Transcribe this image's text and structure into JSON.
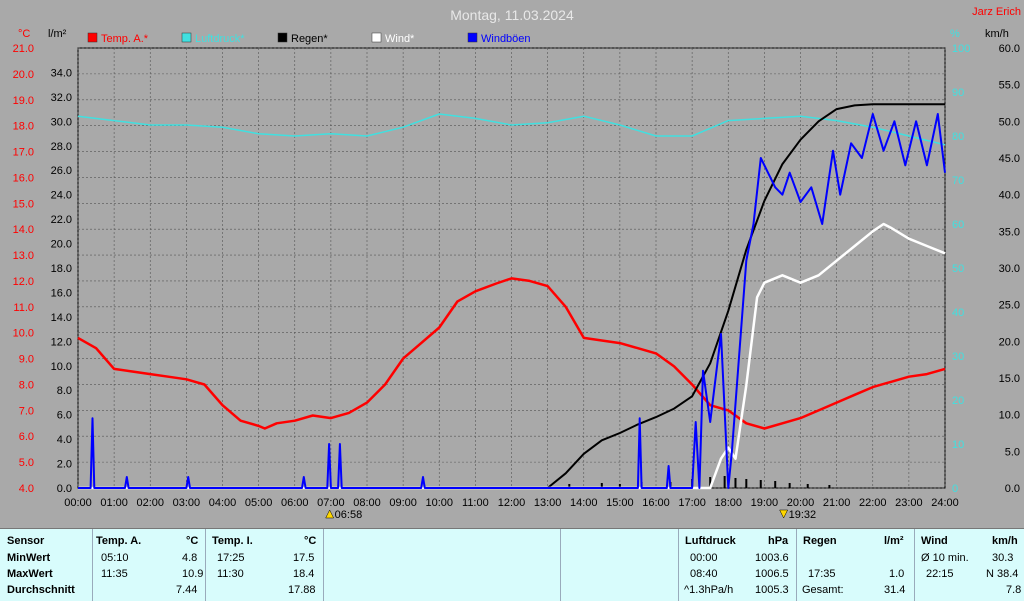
{
  "header": {
    "title": "Montag, 11.03.2024",
    "author": "Jarz Erich"
  },
  "colors": {
    "temp": "#ff0000",
    "pressure": "#40e0e0",
    "rain": "#000000",
    "wind": "#ffffff",
    "gust": "#0000ff",
    "plot_bg": "#a9a9a9",
    "table_bg": "#d8fcfc"
  },
  "legend": [
    {
      "label": "Temp. A.*",
      "color": "#ff0000"
    },
    {
      "label": "Luftdruck*",
      "color": "#40e0e0"
    },
    {
      "label": "Regen*",
      "color": "#000000"
    },
    {
      "label": "Wind*",
      "color": "#ffffff"
    },
    {
      "label": "Windböen",
      "color": "#0000ff"
    }
  ],
  "axes": {
    "temp_unit": "°C",
    "rain_unit": "l/m²",
    "pressure_unit": "%",
    "wind_unit": "km/h",
    "temp_ticks": [
      "21.0",
      "20.0",
      "19.0",
      "18.0",
      "17.0",
      "16.0",
      "15.0",
      "14.0",
      "13.0",
      "12.0",
      "11.0",
      "10.0",
      "9.0",
      "8.0",
      "7.0",
      "6.0",
      "5.0",
      "4.0"
    ],
    "rain_ticks": [
      "34.0",
      "32.0",
      "30.0",
      "28.0",
      "26.0",
      "24.0",
      "22.0",
      "20.0",
      "18.0",
      "16.0",
      "14.0",
      "12.0",
      "10.0",
      "8.0",
      "6.0",
      "4.0",
      "2.0",
      "0.0"
    ],
    "pct_ticks": [
      "100",
      "90",
      "80",
      "70",
      "60",
      "50",
      "40",
      "30",
      "20",
      "10",
      "0"
    ],
    "wind_ticks": [
      "60.0",
      "55.0",
      "50.0",
      "45.0",
      "40.0",
      "35.0",
      "30.0",
      "25.0",
      "20.0",
      "15.0",
      "10.0",
      "5.0",
      "0.0"
    ],
    "time_ticks": [
      "00:00",
      "01:00",
      "02:00",
      "03:00",
      "04:00",
      "05:00",
      "06:00",
      "07:00",
      "08:00",
      "09:00",
      "10:00",
      "11:00",
      "12:00",
      "13:00",
      "14:00",
      "15:00",
      "16:00",
      "17:00",
      "18:00",
      "19:00",
      "20:00",
      "21:00",
      "22:00",
      "23:00",
      "24:00"
    ],
    "sunrise": "06:58",
    "sunset": "19:32"
  },
  "chart_data": {
    "type": "line",
    "x_unit": "hours",
    "series": [
      {
        "name": "Temp. A.*",
        "axis": "temp_C",
        "points": [
          [
            0,
            9.8
          ],
          [
            0.5,
            9.4
          ],
          [
            1,
            8.6
          ],
          [
            1.5,
            8.5
          ],
          [
            2,
            8.4
          ],
          [
            2.5,
            8.3
          ],
          [
            3,
            8.2
          ],
          [
            3.5,
            8.0
          ],
          [
            4,
            7.2
          ],
          [
            4.5,
            6.6
          ],
          [
            5,
            6.4
          ],
          [
            5.17,
            6.3
          ],
          [
            5.5,
            6.5
          ],
          [
            6,
            6.6
          ],
          [
            6.5,
            6.8
          ],
          [
            7,
            6.7
          ],
          [
            7.5,
            6.9
          ],
          [
            8,
            7.3
          ],
          [
            8.5,
            8.0
          ],
          [
            9,
            9.0
          ],
          [
            9.5,
            9.6
          ],
          [
            10,
            10.2
          ],
          [
            10.5,
            11.2
          ],
          [
            11,
            11.6
          ],
          [
            11.58,
            11.9
          ],
          [
            12,
            12.1
          ],
          [
            12.5,
            12.0
          ],
          [
            13,
            11.8
          ],
          [
            13.5,
            11.0
          ],
          [
            14,
            9.8
          ],
          [
            14.5,
            9.7
          ],
          [
            15,
            9.6
          ],
          [
            15.5,
            9.4
          ],
          [
            16,
            9.2
          ],
          [
            16.5,
            8.7
          ],
          [
            17,
            8.0
          ],
          [
            17.5,
            7.2
          ],
          [
            18,
            7.0
          ],
          [
            18.5,
            6.5
          ],
          [
            19,
            6.3
          ],
          [
            19.5,
            6.5
          ],
          [
            20,
            6.7
          ],
          [
            20.5,
            7.0
          ],
          [
            21,
            7.3
          ],
          [
            21.5,
            7.6
          ],
          [
            22,
            7.9
          ],
          [
            22.5,
            8.1
          ],
          [
            23,
            8.3
          ],
          [
            23.5,
            8.4
          ],
          [
            24,
            8.6
          ]
        ]
      },
      {
        "name": "Luftdruck*",
        "axis": "pct",
        "points": [
          [
            0,
            84.5
          ],
          [
            1,
            83.5
          ],
          [
            2,
            82.5
          ],
          [
            3,
            82.5
          ],
          [
            4,
            82
          ],
          [
            5,
            80.5
          ],
          [
            6,
            80
          ],
          [
            7,
            80.5
          ],
          [
            8,
            80
          ],
          [
            9,
            82
          ],
          [
            10,
            85
          ],
          [
            11,
            84
          ],
          [
            12,
            82.5
          ],
          [
            13,
            83
          ],
          [
            14,
            84.5
          ],
          [
            15,
            82.5
          ],
          [
            16,
            80
          ],
          [
            17,
            80
          ],
          [
            18,
            83.5
          ],
          [
            19,
            84
          ],
          [
            20,
            84.5
          ],
          [
            21,
            83.5
          ],
          [
            22,
            82
          ],
          [
            23,
            80
          ],
          [
            24,
            78
          ]
        ]
      },
      {
        "name": "Regen*",
        "axis": "rain_lm2",
        "points": [
          [
            0,
            0
          ],
          [
            13,
            0
          ],
          [
            13.5,
            1.2
          ],
          [
            14,
            2.8
          ],
          [
            14.5,
            3.9
          ],
          [
            15,
            4.5
          ],
          [
            15.5,
            5.2
          ],
          [
            16,
            5.8
          ],
          [
            16.5,
            6.5
          ],
          [
            17,
            7.5
          ],
          [
            17.5,
            10.2
          ],
          [
            18,
            14.5
          ],
          [
            18.5,
            19.5
          ],
          [
            19,
            23.5
          ],
          [
            19.5,
            26.5
          ],
          [
            20,
            28.5
          ],
          [
            20.5,
            30.0
          ],
          [
            21,
            31.0
          ],
          [
            21.5,
            31.3
          ],
          [
            22,
            31.4
          ],
          [
            24,
            31.4
          ]
        ]
      },
      {
        "name": "Wind*",
        "axis": "wind_kmh",
        "points": [
          [
            0,
            0
          ],
          [
            17.5,
            0
          ],
          [
            17.8,
            4
          ],
          [
            18,
            5.5
          ],
          [
            18.2,
            4
          ],
          [
            18.5,
            14
          ],
          [
            18.8,
            26
          ],
          [
            19,
            28
          ],
          [
            19.5,
            29
          ],
          [
            20,
            28
          ],
          [
            20.5,
            29
          ],
          [
            21,
            31
          ],
          [
            21.5,
            33
          ],
          [
            22,
            35
          ],
          [
            22.3,
            36
          ],
          [
            22.5,
            35.5
          ],
          [
            23,
            34
          ],
          [
            23.5,
            33
          ],
          [
            24,
            32
          ]
        ]
      },
      {
        "name": "Windböen",
        "axis": "wind_kmh",
        "points": [
          [
            0,
            0
          ],
          [
            0.35,
            0
          ],
          [
            0.4,
            9.5
          ],
          [
            0.45,
            0
          ],
          [
            1.3,
            0
          ],
          [
            1.35,
            1.5
          ],
          [
            1.4,
            0
          ],
          [
            3,
            0
          ],
          [
            3.05,
            1.5
          ],
          [
            3.1,
            0
          ],
          [
            6.2,
            0
          ],
          [
            6.25,
            1.5
          ],
          [
            6.3,
            0
          ],
          [
            6.9,
            0
          ],
          [
            6.95,
            6
          ],
          [
            7.0,
            0
          ],
          [
            7.2,
            0
          ],
          [
            7.25,
            6
          ],
          [
            7.3,
            0
          ],
          [
            9.5,
            0
          ],
          [
            9.55,
            1.5
          ],
          [
            9.6,
            0
          ],
          [
            15.5,
            0
          ],
          [
            15.55,
            9.5
          ],
          [
            15.6,
            0
          ],
          [
            16.3,
            0
          ],
          [
            16.35,
            3
          ],
          [
            16.4,
            0
          ],
          [
            17.0,
            0
          ],
          [
            17.1,
            9
          ],
          [
            17.2,
            0
          ],
          [
            17.3,
            16
          ],
          [
            17.5,
            9
          ],
          [
            17.8,
            21
          ],
          [
            18,
            0
          ],
          [
            18.1,
            5
          ],
          [
            18.3,
            18
          ],
          [
            18.5,
            31
          ],
          [
            18.7,
            36
          ],
          [
            18.9,
            45
          ],
          [
            19.1,
            43
          ],
          [
            19.3,
            41
          ],
          [
            19.5,
            40
          ],
          [
            19.7,
            43
          ],
          [
            20,
            39
          ],
          [
            20.3,
            41
          ],
          [
            20.6,
            36
          ],
          [
            20.9,
            46
          ],
          [
            21.1,
            40
          ],
          [
            21.4,
            47
          ],
          [
            21.7,
            45
          ],
          [
            22,
            51
          ],
          [
            22.3,
            46
          ],
          [
            22.6,
            50
          ],
          [
            22.9,
            44
          ],
          [
            23.2,
            50
          ],
          [
            23.5,
            44
          ],
          [
            23.8,
            51
          ],
          [
            24,
            43
          ]
        ]
      }
    ],
    "rain_bars": [
      [
        13.6,
        0.4
      ],
      [
        14.5,
        0.5
      ],
      [
        15.0,
        0.4
      ],
      [
        15.6,
        0.6
      ],
      [
        16.4,
        0.6
      ],
      [
        17.0,
        0.9
      ],
      [
        17.5,
        1.1
      ],
      [
        17.9,
        1.2
      ],
      [
        18.2,
        1.0
      ],
      [
        18.5,
        0.9
      ],
      [
        18.9,
        0.8
      ],
      [
        19.3,
        0.7
      ],
      [
        19.7,
        0.5
      ],
      [
        20.2,
        0.4
      ],
      [
        20.8,
        0.3
      ]
    ]
  },
  "table": {
    "rows": [
      "Sensor",
      "MinWert",
      "MaxWert",
      "Durchschnitt"
    ],
    "temp_a": {
      "head": "Temp. A.",
      "unit": "°C",
      "min_time": "05:10",
      "min": "4.8",
      "max_time": "11:35",
      "max": "10.9",
      "avg": "7.44"
    },
    "temp_i": {
      "head": "Temp. I.",
      "unit": "°C",
      "min_time": "17:25",
      "min": "17.5",
      "max_time": "11:30",
      "max": "18.4",
      "avg": "17.88"
    },
    "luftdruck": {
      "head": "Luftdruck",
      "unit": "hPa",
      "min_time": "00:00",
      "min": "1003.6",
      "max_time": "08:40",
      "max": "1006.5",
      "trend": "^1.3hPa/h",
      "avg": "1005.3"
    },
    "regen": {
      "head": "Regen",
      "unit": "l/m²",
      "max_time": "17:35",
      "max": "1.0",
      "total_label": "Gesamt:",
      "total": "31.4"
    },
    "wind": {
      "head": "Wind",
      "unit": "km/h",
      "avg_label": "Ø 10 min.",
      "avg": "30.3",
      "gust_time": "22:15",
      "gust": "N 38.4",
      "mean": "7.8"
    }
  }
}
